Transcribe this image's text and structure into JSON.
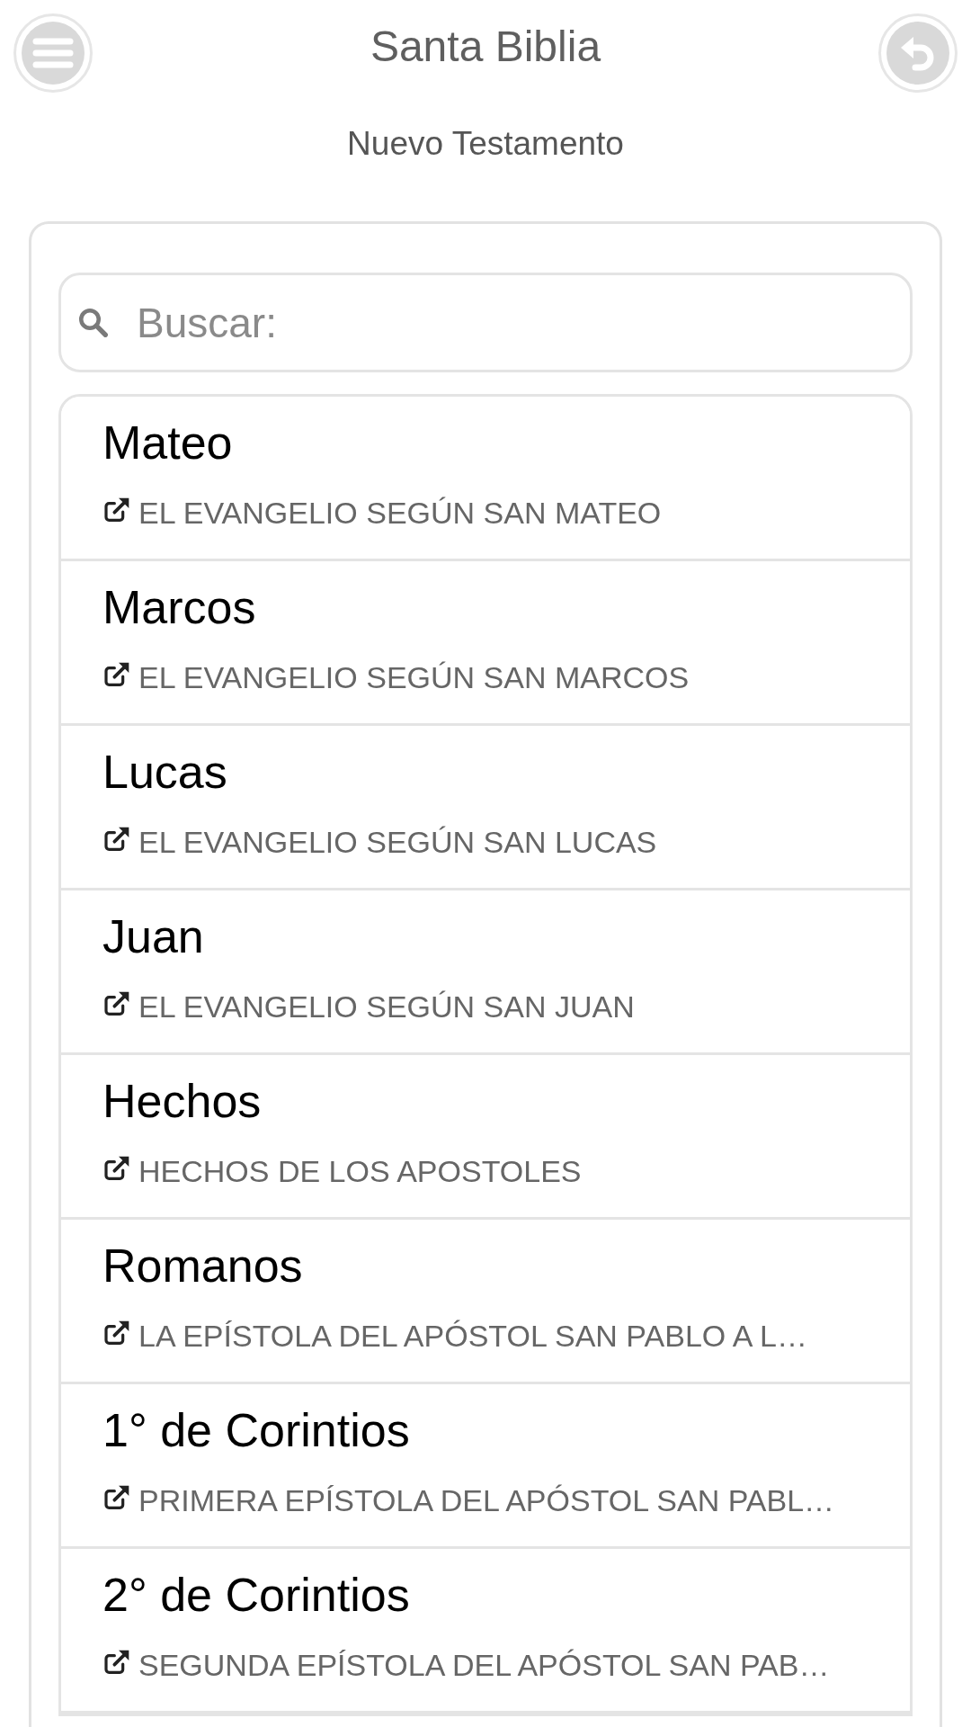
{
  "header": {
    "title": "Santa Biblia",
    "subtitle": "Nuevo Testamento"
  },
  "search": {
    "placeholder": "Buscar:"
  },
  "books": [
    {
      "name": "Mateo",
      "description": "EL EVANGELIO SEGÚN SAN MATEO"
    },
    {
      "name": "Marcos",
      "description": "EL EVANGELIO SEGÚN SAN MARCOS"
    },
    {
      "name": "Lucas",
      "description": "EL EVANGELIO SEGÚN SAN LUCAS"
    },
    {
      "name": "Juan",
      "description": "EL EVANGELIO SEGÚN SAN JUAN"
    },
    {
      "name": "Hechos",
      "description": "HECHOS DE LOS APOSTOLES"
    },
    {
      "name": "Romanos",
      "description": "LA EPÍSTOLA DEL APÓSTOL SAN PABLO A L…"
    },
    {
      "name": "1° de Corintios",
      "description": "PRIMERA EPÍSTOLA DEL APÓSTOL SAN PABL…"
    },
    {
      "name": "2° de Corintios",
      "description": "SEGUNDA EPÍSTOLA DEL APÓSTOL SAN PAB…"
    }
  ]
}
